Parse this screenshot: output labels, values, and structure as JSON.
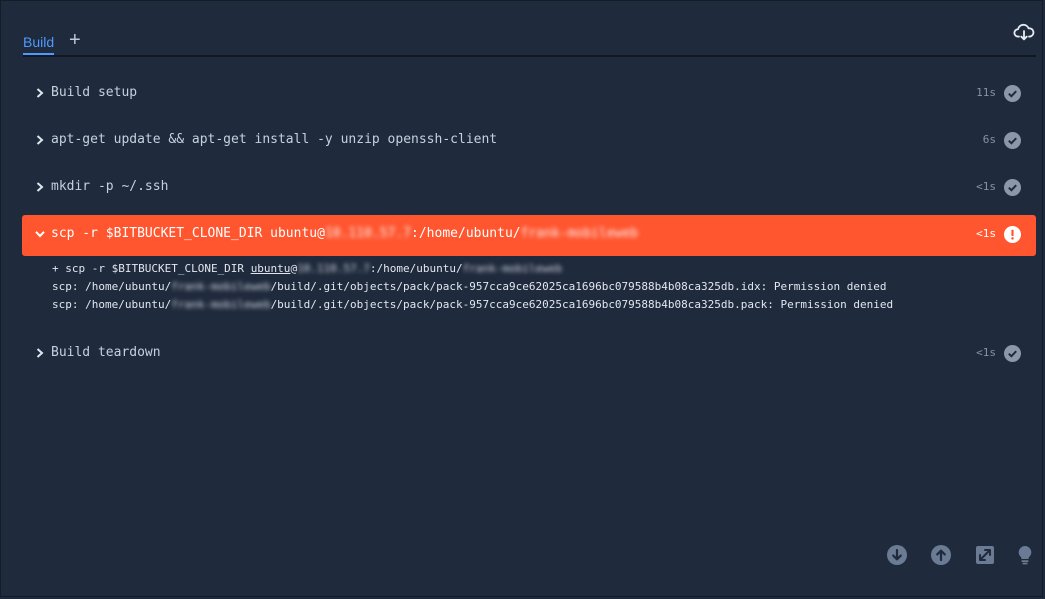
{
  "tabs": {
    "build_label": "Build",
    "add_label": "+"
  },
  "steps": [
    {
      "command": "Build setup",
      "duration": "11s",
      "status": "success"
    },
    {
      "command": "apt-get update && apt-get install -y unzip openssh-client",
      "duration": "6s",
      "status": "success"
    },
    {
      "command": "mkdir -p ~/.ssh",
      "duration": "<1s",
      "status": "success"
    },
    {
      "command_prefix": "scp -r $BITBUCKET_CLONE_DIR ubuntu@",
      "command_ip": "10.110.57.7",
      "command_mid": ":/home/ubuntu/",
      "command_dir": "frank-mobileweb",
      "duration": "<1s",
      "status": "failed"
    },
    {
      "command": "Build teardown",
      "duration": "<1s",
      "status": "success"
    }
  ],
  "log": {
    "line1_prefix": "+ scp -r $BITBUCKET_CLONE_DIR ",
    "line1_user": "ubuntu",
    "line1_at": "@",
    "line1_ip": "10.110.57.7",
    "line1_mid": ":/home/ubuntu/",
    "line1_dir": "frank-mobileweb",
    "line2_prefix": "scp: /home/ubuntu/",
    "line2_dir": "frank-mobileweb",
    "line2_suffix": "/build/.git/objects/pack/pack-957cca9ce62025ca1696bc079588b4b08ca325db.idx: Permission denied",
    "line3_prefix": "scp: /home/ubuntu/",
    "line3_dir": "frank-mobileweb",
    "line3_suffix": "/build/.git/objects/pack/pack-957cca9ce62025ca1696bc079588b4b08ca325db.pack: Permission denied"
  },
  "icons": {
    "download": "cloud-download-icon",
    "scroll_bottom": "arrow-down-icon",
    "scroll_top": "arrow-up-icon",
    "expand": "expand-icon",
    "tips": "lightbulb-icon",
    "success": "check-circle-icon",
    "failed": "error-circle-icon",
    "chevron": "chevron-icon"
  },
  "colors": {
    "background": "#1f2a3c",
    "accent": "#4c9aff",
    "failed": "#ff5630",
    "success_icon": "#8c97a8"
  }
}
